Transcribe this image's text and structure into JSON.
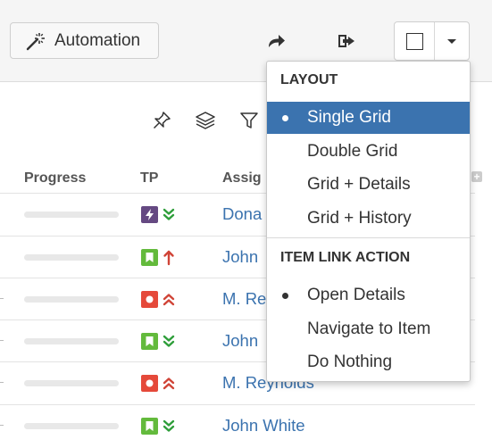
{
  "toolbar": {
    "automation_label": "Automation",
    "automation_icon": "magic-wand-icon",
    "share_icon": "share-arrow-icon",
    "export_icon": "export-icon",
    "layout_icon": "square-icon",
    "dropdown_icon": "caret-down-icon"
  },
  "subtoolbar": {
    "icons": [
      "pin-icon",
      "layers-icon",
      "filter-icon"
    ]
  },
  "grid": {
    "columns": {
      "progress": "Progress",
      "tp": "TP",
      "assignee": "Assig"
    },
    "rows": [
      {
        "type": "epic",
        "priority": "low",
        "assignee": "Dona",
        "type_color": "#654982",
        "priority_color": "#2e9e3a"
      },
      {
        "type": "story",
        "priority": "highest",
        "assignee": "John",
        "type_color": "#63ba3c",
        "priority_color": "#d04437"
      },
      {
        "type": "bug",
        "priority": "high",
        "assignee": "M. Re",
        "type_color": "#e5493a",
        "priority_color": "#d04437"
      },
      {
        "type": "story",
        "priority": "low",
        "assignee": "John",
        "type_color": "#63ba3c",
        "priority_color": "#2e9e3a"
      },
      {
        "type": "bug",
        "priority": "high",
        "assignee": "M. Reynolds",
        "type_color": "#e5493a",
        "priority_color": "#d04437"
      },
      {
        "type": "story",
        "priority": "low",
        "assignee": "John White",
        "type_color": "#63ba3c",
        "priority_color": "#2e9e3a"
      }
    ]
  },
  "menu": {
    "layout_header": "LAYOUT",
    "layout_items": [
      "Single Grid",
      "Double Grid",
      "Grid + Details",
      "Grid + History"
    ],
    "layout_selected": "Single Grid",
    "link_header": "ITEM LINK ACTION",
    "link_items": [
      "Open Details",
      "Navigate to Item",
      "Do Nothing"
    ],
    "link_selected": "Open Details",
    "accent_color": "#3b73af"
  }
}
